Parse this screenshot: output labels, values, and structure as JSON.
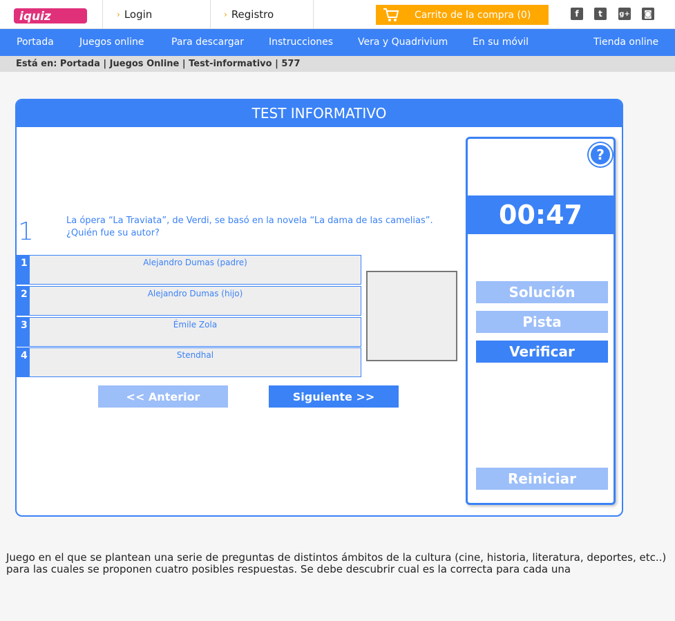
{
  "header": {
    "login_label": "Login",
    "registro_label": "Registro",
    "cart_label": "Carrito de la compra (0)"
  },
  "social": {
    "facebook": "f",
    "twitter": "t",
    "googleplus": "g+",
    "instagram": "◙"
  },
  "nav": {
    "items": [
      "Portada",
      "Juegos online",
      "Para descargar",
      "Instrucciones",
      "Vera y Quadrivium",
      "En su móvil",
      "Tienda online"
    ]
  },
  "breadcrumb": "Está en: Portada | Juegos Online | Test-informativo | 577",
  "quiz": {
    "title": "TEST INFORMATIVO",
    "question_number": "1",
    "question": "La ópera “La Traviata”, de Verdi, se basó en la novela “La dama de las camelias”. ¿Quién fue su autor?",
    "answers": [
      {
        "num": "1",
        "text": "Alejandro Dumas (padre)"
      },
      {
        "num": "2",
        "text": "Alejandro Dumas (hijo)"
      },
      {
        "num": "3",
        "text": "Émile Zola"
      },
      {
        "num": "4",
        "text": "Stendhal"
      }
    ],
    "prev_label": "<< Anterior",
    "next_label": "Siguiente >>"
  },
  "side": {
    "help_label": "?",
    "timer": "00:47",
    "solucion_label": "Solución",
    "pista_label": "Pista",
    "verificar_label": "Verificar",
    "reiniciar_label": "Reiniciar"
  },
  "description": "Juego en el que se plantean una serie de preguntas de distintos ámbitos de la cultura (cine, historia, literatura, deportes, etc..) para las cuales se proponen cuatro posibles respuestas. Se debe descubrir cual es la correcta para cada una",
  "colors": {
    "primary": "#3b82f6",
    "primary_light": "#9cbef9",
    "cart": "#ffa800",
    "logo_pink": "#e0307a"
  },
  "icons": {
    "cart": "cart-icon",
    "help": "help-icon"
  }
}
